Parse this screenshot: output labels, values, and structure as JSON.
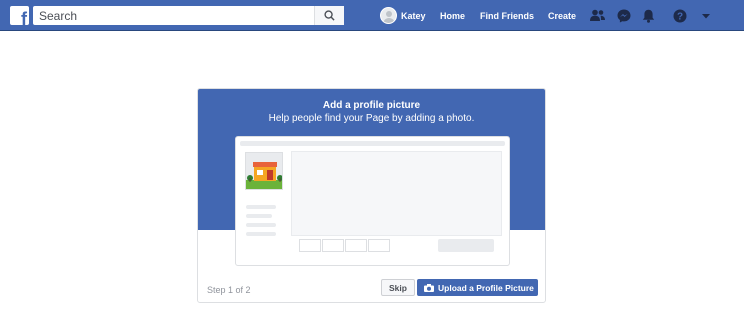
{
  "topbar": {
    "logo": "f",
    "search_placeholder": "Search",
    "user_name": "Katey",
    "links": {
      "home": "Home",
      "find_friends": "Find Friends",
      "create": "Create"
    },
    "icons": [
      "friend-requests-icon",
      "messenger-icon",
      "notifications-icon",
      "help-icon",
      "account-menu-chevron-icon"
    ]
  },
  "card": {
    "title": "Add a profile picture",
    "subtitle": "Help people find your Page by adding a photo.",
    "step": "Step 1 of 2",
    "skip_label": "Skip",
    "upload_label": "Upload a Profile Picture"
  },
  "colors": {
    "brand_blue": "#4267b2",
    "page_bg": "#ffffff",
    "placeholder_gray": "#e9ebee"
  }
}
